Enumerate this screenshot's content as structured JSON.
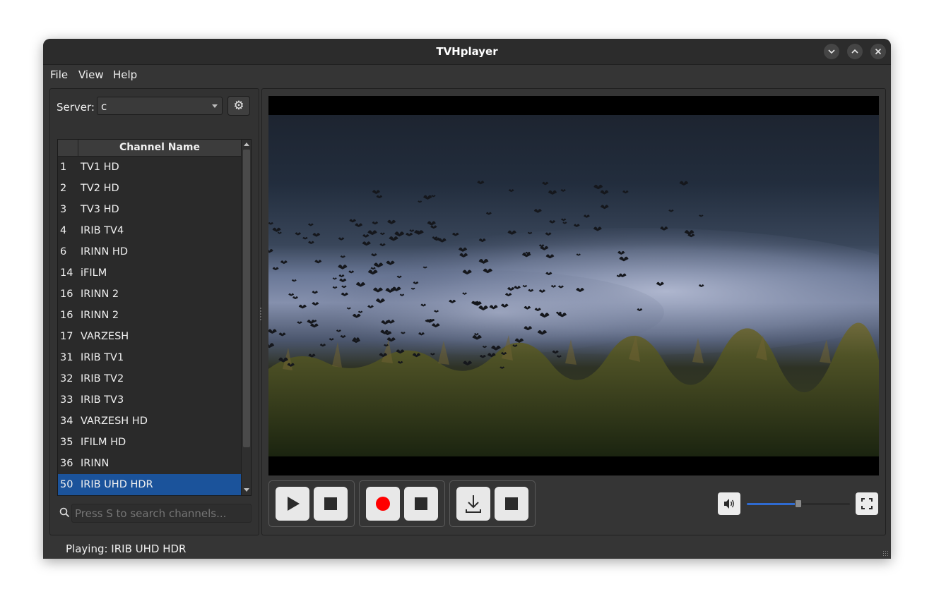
{
  "window": {
    "title": "TVHplayer",
    "controls": [
      "minimize-icon",
      "maximize-icon",
      "close-icon"
    ]
  },
  "menu": {
    "items": [
      {
        "label": "File"
      },
      {
        "label": "View"
      },
      {
        "label": "Help"
      }
    ]
  },
  "server": {
    "label": "Server:",
    "selected": "c",
    "settings_icon": "gear-icon"
  },
  "channels": {
    "header": "Channel Name",
    "rows": [
      {
        "num": "1",
        "name": "TV1 HD"
      },
      {
        "num": "2",
        "name": "TV2 HD"
      },
      {
        "num": "3",
        "name": "TV3 HD"
      },
      {
        "num": "4",
        "name": "IRIB TV4"
      },
      {
        "num": "6",
        "name": "IRINN HD"
      },
      {
        "num": "14",
        "name": "iFILM"
      },
      {
        "num": "16",
        "name": "IRINN 2"
      },
      {
        "num": "16",
        "name": "IRINN 2"
      },
      {
        "num": "17",
        "name": "VARZESH"
      },
      {
        "num": "31",
        "name": "IRIB TV1"
      },
      {
        "num": "32",
        "name": "IRIB TV2"
      },
      {
        "num": "33",
        "name": "IRIB TV3"
      },
      {
        "num": "34",
        "name": "VARZESH HD"
      },
      {
        "num": "35",
        "name": "IFILM HD"
      },
      {
        "num": "36",
        "name": "IRINN"
      },
      {
        "num": "50",
        "name": "IRIB UHD HDR"
      }
    ],
    "selected_index": 15
  },
  "search": {
    "placeholder": "Press S to search channels...",
    "icon": "search-icon"
  },
  "player": {
    "controls": {
      "playback": [
        "play-icon",
        "stop-icon"
      ],
      "record": [
        "record-icon",
        "stop-icon"
      ],
      "download": [
        "download-icon",
        "stop-icon"
      ]
    },
    "volume_fraction": 0.5,
    "volume_icon": "volume-icon",
    "fullscreen_icon": "fullscreen-icon",
    "record_color": "#ff0000",
    "accent_color": "#2f6bd1"
  },
  "status": {
    "text": "Playing: IRIB UHD HDR"
  }
}
